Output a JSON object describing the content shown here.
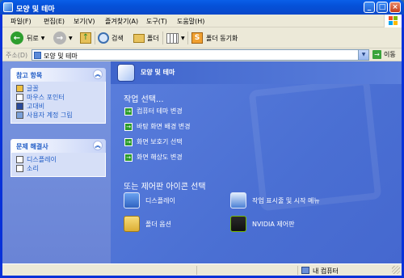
{
  "window": {
    "title": "모양 및 테마"
  },
  "menu": [
    "파일(F)",
    "편집(E)",
    "보기(V)",
    "즐겨찾기(A)",
    "도구(T)",
    "도움말(H)"
  ],
  "toolbar": {
    "back": "뒤로",
    "search": "검색",
    "folders": "폴더",
    "sync": "폴더 동기화"
  },
  "address": {
    "label": "주소(D)",
    "value": "모양 및 테마",
    "go": "이동"
  },
  "sidebar": {
    "see_also": {
      "title": "참고 항목",
      "items": [
        "글꼴",
        "마우스 포인터",
        "고대비",
        "사용자 계정 그림"
      ]
    },
    "troubleshoot": {
      "title": "문제 해결사",
      "items": [
        "디스플레이",
        "소리"
      ]
    }
  },
  "content": {
    "header": "모양 및 테마",
    "pick_task": "작업 선택...",
    "tasks": [
      "컴퓨터 테마 변경",
      "바탕 화면 배경 변경",
      "화면 보호기 선택",
      "화면 해상도 변경"
    ],
    "pick_icon": "또는 제어판 아이콘 선택",
    "icons": [
      "디스플레이",
      "작업 표시줄 및 시작 메뉴",
      "폴더 옵션",
      "NVIDIA 제어판"
    ]
  },
  "status": {
    "zone": "내 컴퓨터"
  }
}
